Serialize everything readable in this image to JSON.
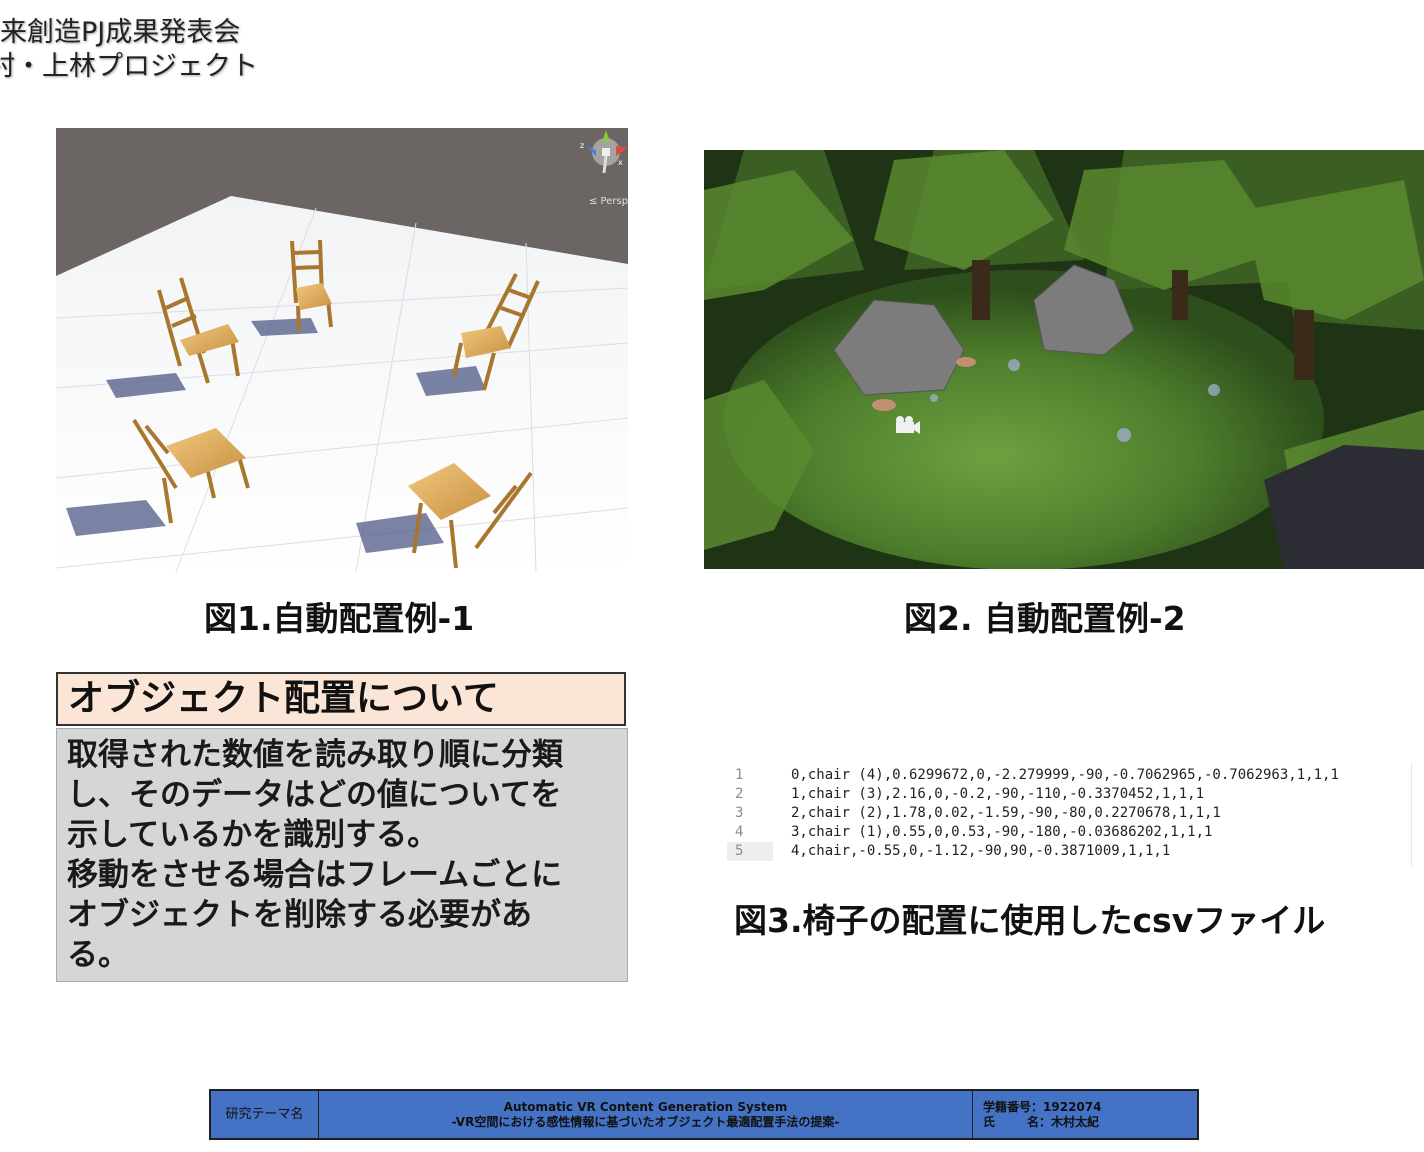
{
  "header": {
    "line1": "来創造PJ成果発表会",
    "line2": "村・上林プロジェクト"
  },
  "figure1": {
    "caption": "図1.自動配置例-1",
    "gizmo_label": "≤ Persp",
    "axis_x": "x",
    "axis_z": "z"
  },
  "figure2": {
    "caption": "図2. 自動配置例-2"
  },
  "figure3": {
    "caption": "図3.椅子の配置に使用したcsvファイル",
    "rows": [
      {
        "num": "1",
        "text": "0,chair (4),0.6299672,0,-2.279999,-90,-0.7062965,-0.7062963,1,1,1"
      },
      {
        "num": "2",
        "text": "1,chair (3),2.16,0,-0.2,-90,-110,-0.3370452,1,1,1"
      },
      {
        "num": "3",
        "text": "2,chair (2),1.78,0.02,-1.59,-90,-80,0.2270678,1,1,1"
      },
      {
        "num": "4",
        "text": "3,chair (1),0.55,0,0.53,-90,-180,-0.03686202,1,1,1"
      },
      {
        "num": "5",
        "text": "4,chair,-0.55,0,-1.12,-90,90,-0.3871009,1,1,1"
      }
    ]
  },
  "info_box": {
    "title": "オブジェクト配置について",
    "lines": [
      "取得された数値を読み取り順に分類",
      "し、そのデータはどの値についてを",
      "示しているかを識別する。",
      "移動をさせる場合はフレームごとに",
      "オブジェクトを削除する必要があ",
      "る。"
    ]
  },
  "footer": {
    "theme_label": "研究テーマ名",
    "title_en": "Automatic VR Content Generation System",
    "title_jp": "-VR空間における感性情報に基づいたオブジェクト最適配置手法の提案-",
    "student_id_label": "学籍番号：",
    "student_id": "1922074",
    "name_label_1": "氏",
    "name_label_2": "名：",
    "name": "木村太紀"
  },
  "colors": {
    "footer_bg": "#4472c4",
    "box_title_bg": "#fbe5d6",
    "box_body_bg": "#d6d6d6"
  }
}
